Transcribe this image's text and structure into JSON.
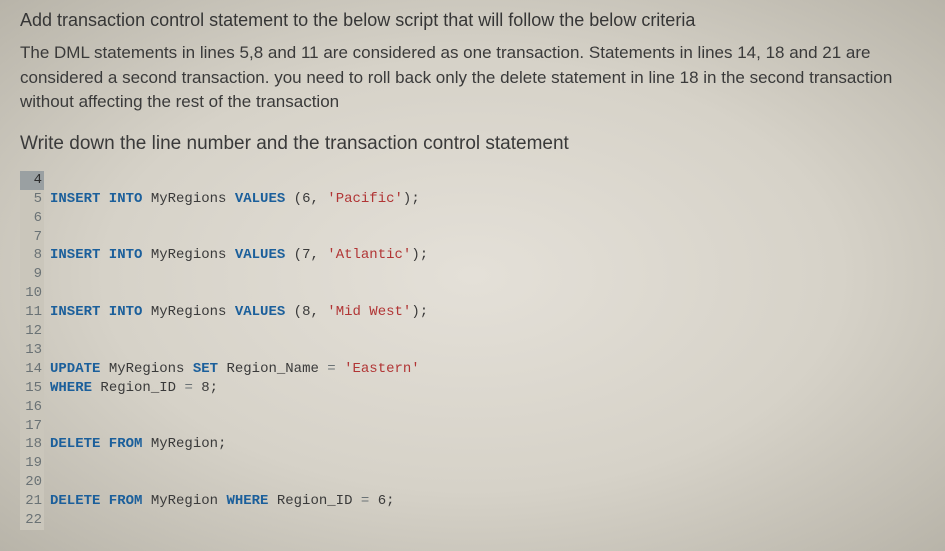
{
  "title": "Add transaction control statement to the below script that will follow the below criteria",
  "body": "The DML statements in lines 5,8 and 11 are considered as one transaction. Statements in lines 14, 18 and 21 are considered a second transaction. you need to roll back only the delete statement in line 18 in the second transaction without affecting the rest of the transaction",
  "instruction": "Write down the line number and the transaction control statement",
  "code": {
    "l4": "4",
    "l5": "5",
    "l5_insert": "INSERT INTO",
    "l5_table": " MyRegions ",
    "l5_values": "VALUES",
    "l5_open": " (",
    "l5_num": "6",
    "l5_comma": ", ",
    "l5_str": "'Pacific'",
    "l5_close": ");",
    "l6": "6",
    "l7": "7",
    "l8": "8",
    "l8_insert": "INSERT INTO",
    "l8_table": " MyRegions ",
    "l8_values": "VALUES",
    "l8_open": " (",
    "l8_num": "7",
    "l8_comma": ", ",
    "l8_str": "'Atlantic'",
    "l8_close": ");",
    "l9": "9",
    "l10": "10",
    "l11": "11",
    "l11_insert": "INSERT INTO",
    "l11_table": " MyRegions ",
    "l11_values": "VALUES",
    "l11_open": " (",
    "l11_num": "8",
    "l11_comma": ", ",
    "l11_str": "'Mid West'",
    "l11_close": ");",
    "l12": "12",
    "l13": "13",
    "l14": "14",
    "l14_update": "UPDATE",
    "l14_table": " MyRegions ",
    "l14_set": "SET",
    "l14_col": " Region_Name ",
    "l14_eq": "= ",
    "l14_str": "'Eastern'",
    "l15": "15",
    "l15_where": "WHERE",
    "l15_col": " Region_ID ",
    "l15_eq": "= ",
    "l15_num": "8",
    "l15_semi": ";",
    "l16": "16",
    "l17": "17",
    "l18": "18",
    "l18_delete": "DELETE FROM",
    "l18_table": " MyRegion;",
    "l19": "19",
    "l20": "20",
    "l21": "21",
    "l21_delete": "DELETE FROM",
    "l21_table": " MyRegion ",
    "l21_where": "WHERE",
    "l21_col": " Region_ID ",
    "l21_eq": "= ",
    "l21_num": "6",
    "l21_semi": ";",
    "l22": "22"
  }
}
